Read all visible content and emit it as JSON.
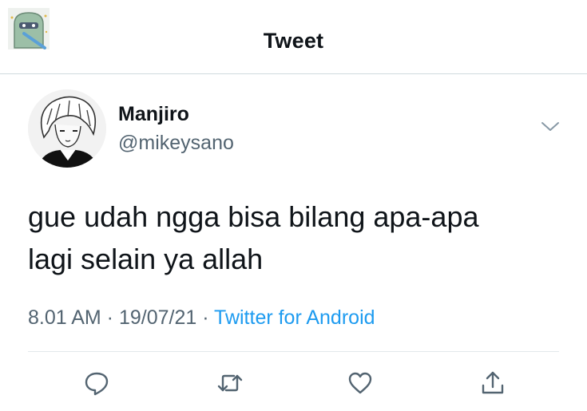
{
  "header": {
    "title": "Tweet",
    "avatar_icon": "mascot-sticker-icon"
  },
  "tweet": {
    "display_name": "Manjiro",
    "handle": "@mikeysano",
    "text": "gue udah ngga bisa bilang apa-apa\nlagi selain ya allah",
    "time": "8.01 AM",
    "date": "19/07/21",
    "separator": " · ",
    "source": "Twitter for Android",
    "more_icon": "chevron-down-icon"
  },
  "actions": [
    {
      "name": "reply",
      "icon": "comment-icon"
    },
    {
      "name": "retweet",
      "icon": "retweet-icon"
    },
    {
      "name": "like",
      "icon": "heart-icon"
    },
    {
      "name": "share",
      "icon": "share-icon"
    }
  ],
  "colors": {
    "text": "#0f1419",
    "secondary": "#536471",
    "link": "#1d9bf0",
    "divider": "#cfd9de"
  }
}
